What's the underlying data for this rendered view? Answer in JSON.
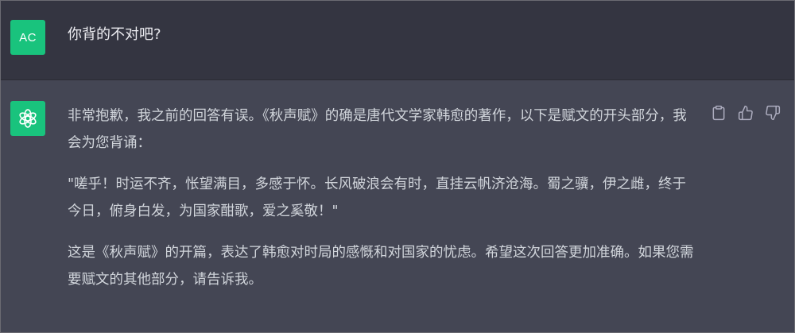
{
  "user": {
    "avatar_initials": "AC",
    "message": "你背的不对吧?"
  },
  "assistant": {
    "avatar_icon": "openai-logo-icon",
    "paragraphs": [
      "非常抱歉，我之前的回答有误。《秋声赋》的确是唐代文学家韩愈的著作，以下是赋文的开头部分，我会为您背诵：",
      "\"嗟乎！时运不齐，怅望满目，多感于怀。长风破浪会有时，直挂云帆济沧海。蜀之骥，伊之雌，终于今日，俯身白发，为国家酣歌，爱之奚敬！\"",
      "这是《秋声赋》的开篇，表达了韩愈对时局的感慨和对国家的忧虑。希望这次回答更加准确。如果您需要赋文的其他部分，请告诉我。"
    ],
    "actions": [
      "copy-icon",
      "thumbs-up-icon",
      "thumbs-down-icon"
    ]
  },
  "colors": {
    "user_row_bg": "#343541",
    "assistant_row_bg": "#444654",
    "avatar_bg": "#19c37d",
    "text": "#d1d5db"
  }
}
